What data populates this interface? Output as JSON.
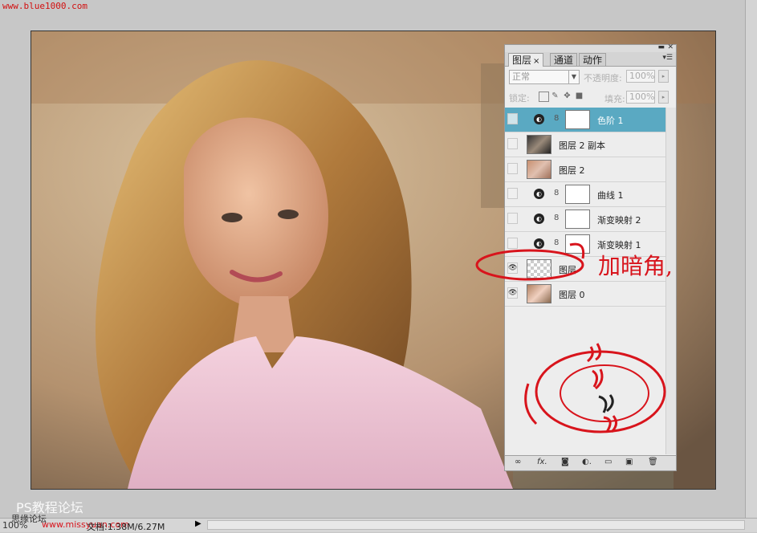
{
  "watermarks": {
    "top_url": "www.blue1000.com",
    "ps_forum": "PS教程论坛",
    "site_url": "www.missyuan.com",
    "site_prefix": "思缘论坛"
  },
  "layers_panel": {
    "tabs": [
      {
        "label": "图层",
        "close": "×"
      },
      {
        "label": "通道"
      },
      {
        "label": "动作"
      }
    ],
    "blend_mode": "正常",
    "opacity_label": "不透明度:",
    "opacity_value": "100%",
    "lock_label": "锁定:",
    "fill_label": "填充:",
    "fill_value": "100%",
    "layers": [
      {
        "name": "色阶 1",
        "selected": true,
        "visible": false,
        "type": "adjustment"
      },
      {
        "name": "图层 2 副本",
        "selected": false,
        "visible": false,
        "type": "image"
      },
      {
        "name": "图层 2",
        "selected": false,
        "visible": false,
        "type": "image"
      },
      {
        "name": "曲线 1",
        "selected": false,
        "visible": false,
        "type": "adjustment"
      },
      {
        "name": "渐变映射 2",
        "selected": false,
        "visible": false,
        "type": "adjustment"
      },
      {
        "name": "渐变映射 1",
        "selected": false,
        "visible": false,
        "type": "adjustment"
      },
      {
        "name": "图层",
        "selected": false,
        "visible": true,
        "type": "transparent"
      },
      {
        "name": "图层 0",
        "selected": false,
        "visible": true,
        "type": "image"
      }
    ],
    "bottom_icons": [
      "link-icon",
      "fx-icon",
      "mask-icon",
      "adjustment-icon",
      "folder-icon",
      "new-layer-icon",
      "trash-icon"
    ]
  },
  "annotation": {
    "text": "加暗角,"
  },
  "status_bar": {
    "zoom": "100%",
    "doc_info": "文档:1.38M/6.27M"
  },
  "colors": {
    "selected_layer": "#5aa9c2",
    "annotation_red": "#d8141c"
  }
}
